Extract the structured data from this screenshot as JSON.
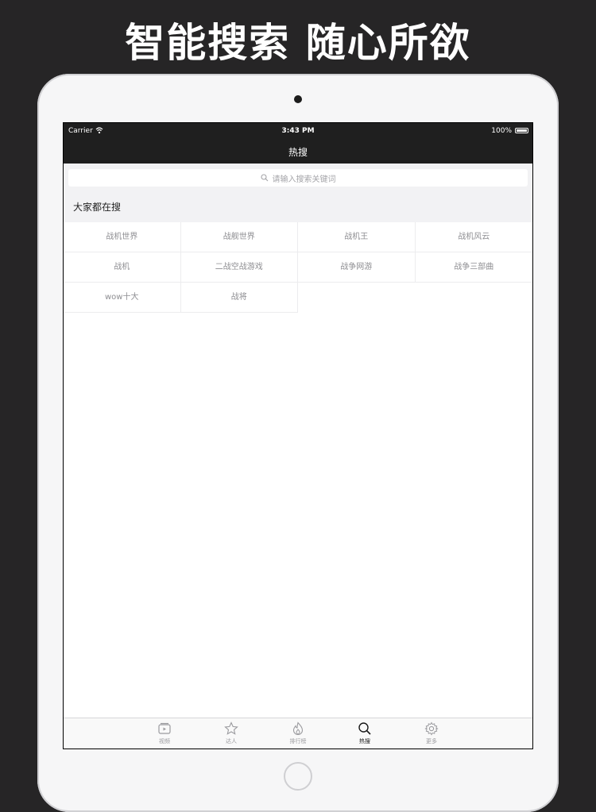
{
  "promo": {
    "title": "智能搜索 随心所欲"
  },
  "status_bar": {
    "carrier": "Carrier",
    "time": "3:43 PM",
    "battery": "100%"
  },
  "nav": {
    "title": "热搜"
  },
  "search": {
    "placeholder": "请输入搜索关键词"
  },
  "section": {
    "title": "大家都在搜"
  },
  "hot_searches": [
    "战机世界",
    "战舰世界",
    "战机王",
    "战机风云",
    "战机",
    "二战空战游戏",
    "战争网游",
    "战争三部曲",
    "wow十大",
    "战将"
  ],
  "tabs": [
    {
      "label": "视频",
      "icon": "video-icon"
    },
    {
      "label": "达人",
      "icon": "star-icon"
    },
    {
      "label": "排行榜",
      "icon": "flame-icon"
    },
    {
      "label": "热搜",
      "icon": "search-icon"
    },
    {
      "label": "更多",
      "icon": "gear-icon"
    }
  ],
  "active_tab": "热搜",
  "colors": {
    "page_bg": "#262526",
    "nav_bg": "#1f1f1f",
    "section_bg": "#f2f2f4",
    "text_muted": "#8e8e92"
  }
}
